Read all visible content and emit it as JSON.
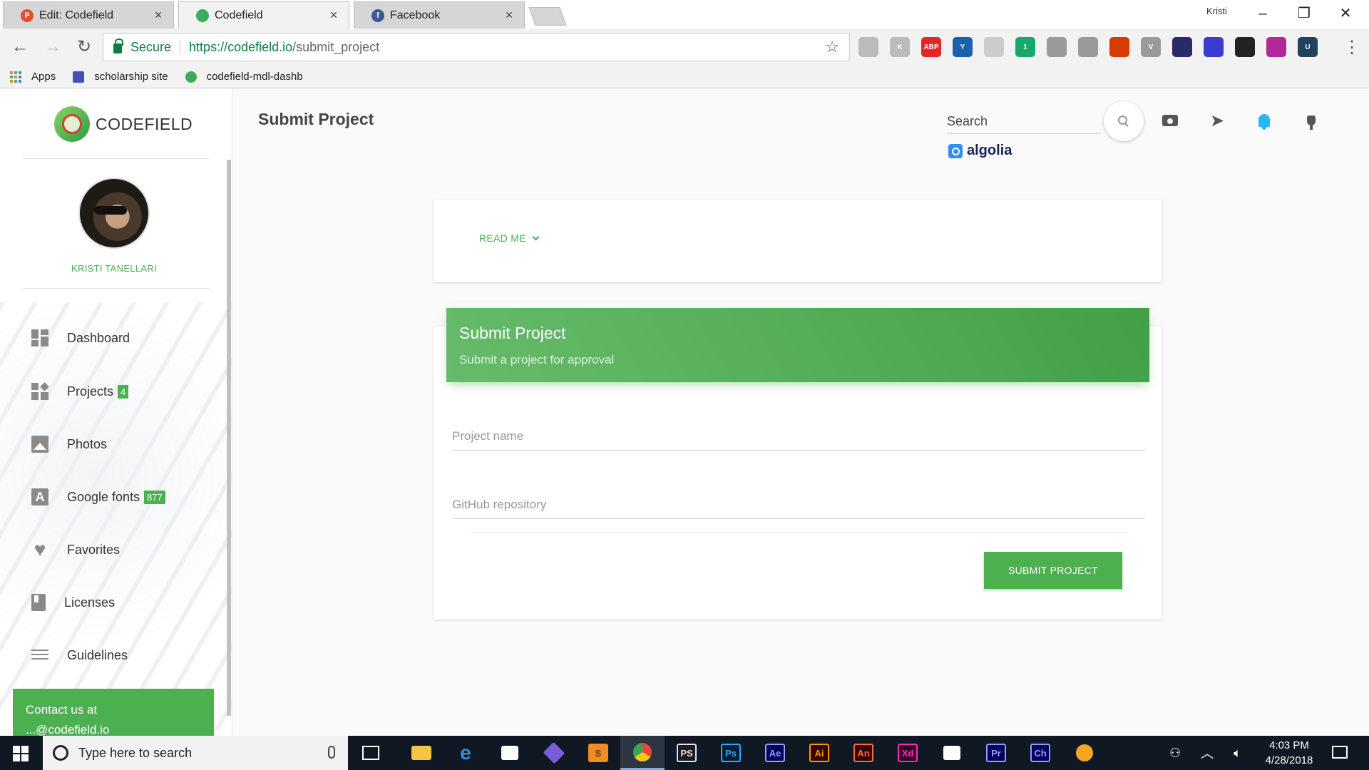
{
  "browser": {
    "tabs": [
      {
        "label": "Edit: Codefield",
        "favicon_color": "#e04e2f",
        "favicon_letter": "P",
        "active": false
      },
      {
        "label": "Codefield",
        "favicon_color": "#3dab5c",
        "favicon_letter": "",
        "active": true
      },
      {
        "label": "Facebook",
        "favicon_color": "#3b5998",
        "favicon_letter": "f",
        "active": false
      }
    ],
    "profile_name": "Kristi",
    "secure_label": "Secure",
    "url_host": "https://codefield.io",
    "url_path": "/submit_project",
    "extensions": [
      {
        "name": "ext-shield-icon",
        "color": "#bbbbbb",
        "text": ""
      },
      {
        "name": "ext-k-icon",
        "color": "#bbbbbb",
        "text": "K"
      },
      {
        "name": "adblock-plus-icon",
        "color": "#e3262a",
        "text": "ABP"
      },
      {
        "name": "ext-y-icon",
        "color": "#1b5fae",
        "text": "Y"
      },
      {
        "name": "ext-camera-icon",
        "color": "#cccccc",
        "text": ""
      },
      {
        "name": "ext-hex-icon",
        "color": "#18a86b",
        "text": "1"
      },
      {
        "name": "ext-grid-icon",
        "color": "#9a9a9a",
        "text": ""
      },
      {
        "name": "ext-screen-icon",
        "color": "#9a9a9a",
        "text": ""
      },
      {
        "name": "ext-office-icon",
        "color": "#d83b01",
        "text": ""
      },
      {
        "name": "ext-v-icon",
        "color": "#9a9a9a",
        "text": "V"
      },
      {
        "name": "ext-speed-icon",
        "color": "#2a2a6a",
        "text": ""
      },
      {
        "name": "ext-pin-icon",
        "color": "#3b3bd1",
        "text": ""
      },
      {
        "name": "ext-flame-icon",
        "color": "#222222",
        "text": ""
      },
      {
        "name": "ext-color-icon",
        "color": "#b3279a",
        "text": ""
      },
      {
        "name": "ext-u-icon",
        "color": "#21415f",
        "text": "U"
      }
    ],
    "bookmarks": [
      {
        "label": "Apps",
        "icon": "apps-grid-icon"
      },
      {
        "label": "scholarship site",
        "icon": "site-icon"
      },
      {
        "label": "codefield-mdl-dashb",
        "icon": "codefield-icon"
      }
    ]
  },
  "sidebar": {
    "brand": "CODEFIELD",
    "user_name": "KRISTI TANELLARI",
    "items": [
      {
        "label": "Dashboard",
        "icon": "dashboard-icon",
        "badge": ""
      },
      {
        "label": "Projects",
        "icon": "projects-icon",
        "badge": "4"
      },
      {
        "label": "Photos",
        "icon": "photos-icon",
        "badge": ""
      },
      {
        "label": "Google fonts",
        "icon": "google-fonts-icon",
        "badge": "877"
      },
      {
        "label": "Favorites",
        "icon": "favorites-icon",
        "badge": ""
      },
      {
        "label": "Licenses",
        "icon": "licenses-icon",
        "badge": ""
      },
      {
        "label": "Guidelines",
        "icon": "guidelines-icon",
        "badge": ""
      }
    ],
    "contact_label": "Contact us at",
    "contact_sub": "...@codefield.io"
  },
  "main": {
    "page_title": "Submit Project",
    "search_label": "Search",
    "algolia_label": "algolia",
    "readme_label": "READ ME",
    "form": {
      "title": "Submit Project",
      "subtitle": "Submit a project for approval",
      "project_name_placeholder": "Project name",
      "github_placeholder": "GitHub repository",
      "submit_label": "SUBMIT PROJECT"
    }
  },
  "taskbar": {
    "search_placeholder": "Type here to search",
    "apps": [
      {
        "name": "file-explorer-icon",
        "text": "",
        "color": "#f5c542",
        "fg": "#f5c542",
        "active": false
      },
      {
        "name": "edge-icon",
        "text": "e",
        "color": "transparent",
        "fg": "#2f8fe0",
        "active": false
      },
      {
        "name": "store-icon",
        "text": "",
        "color": "#ffffff",
        "fg": "#ffffff",
        "active": false
      },
      {
        "name": "git-icon",
        "text": "",
        "color": "#7a5cd9",
        "fg": "#ffffff",
        "active": false
      },
      {
        "name": "sublime-icon",
        "text": "S",
        "color": "#f08c22",
        "fg": "#3a3a3a",
        "active": false
      },
      {
        "name": "chrome-icon",
        "text": "",
        "color": "#e8453c",
        "fg": "#ffffff",
        "active": true
      },
      {
        "name": "phpstorm-icon",
        "text": "PS",
        "color": "#1c1c1c",
        "fg": "#e2dff5",
        "active": false
      },
      {
        "name": "photoshop-icon",
        "text": "Ps",
        "color": "#001d34",
        "fg": "#31a8ff",
        "active": false
      },
      {
        "name": "after-effects-icon",
        "text": "Ae",
        "color": "#00005b",
        "fg": "#9999ff",
        "active": false
      },
      {
        "name": "illustrator-icon",
        "text": "Ai",
        "color": "#330000",
        "fg": "#ff9a00",
        "active": false
      },
      {
        "name": "animate-icon",
        "text": "An",
        "color": "#330000",
        "fg": "#ff6a3d",
        "active": false
      },
      {
        "name": "xd-icon",
        "text": "Xd",
        "color": "#2e001e",
        "fg": "#ff2bc2",
        "active": false
      },
      {
        "name": "mail-icon",
        "text": "",
        "color": "#ffffff",
        "fg": "#ffffff",
        "active": false
      },
      {
        "name": "premiere-icon",
        "text": "Pr",
        "color": "#00005b",
        "fg": "#9999ff",
        "active": false
      },
      {
        "name": "character-animator-icon",
        "text": "Ch",
        "color": "#00005b",
        "fg": "#9999ff",
        "active": false
      },
      {
        "name": "orange-app-icon",
        "text": "",
        "color": "#f5a623",
        "fg": "#ffffff",
        "active": false
      }
    ],
    "time": "4:03 PM",
    "date": "4/28/2018"
  },
  "colors": {
    "accent": "#4caf50",
    "bell": "#29b6f6"
  }
}
